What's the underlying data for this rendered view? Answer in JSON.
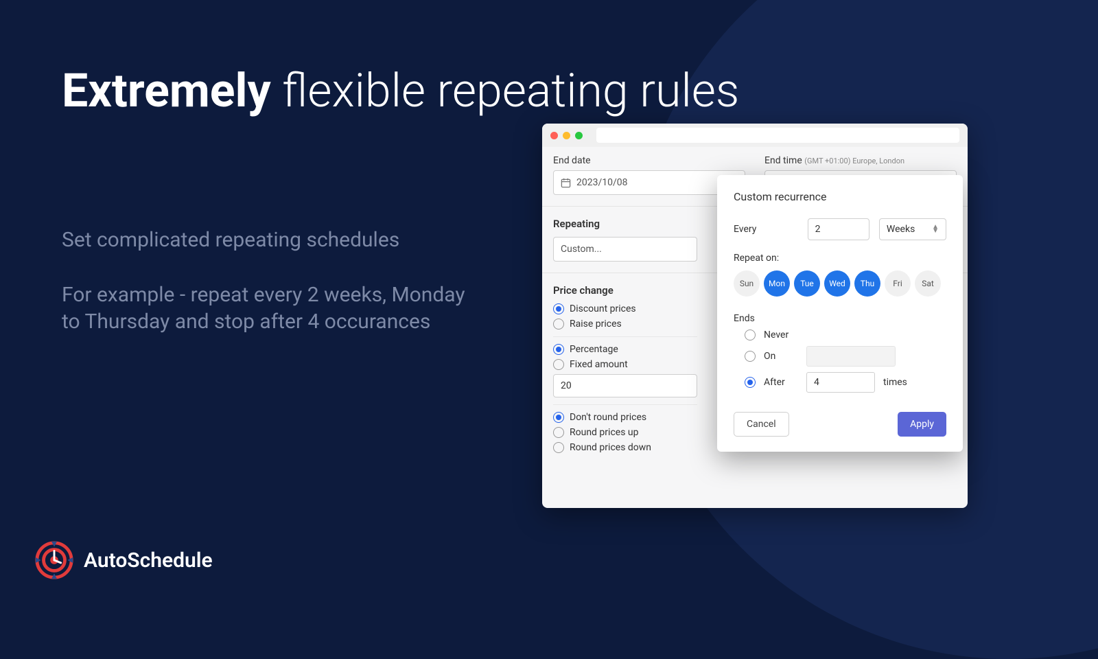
{
  "headline": {
    "bold": "Extremely",
    "rest": " flexible repeating rules"
  },
  "sub1": "Set complicated repeating schedules",
  "sub2": "For example - repeat every 2 weeks, Monday to Thursday and stop after 4 occurances",
  "brand": "AutoSchedule",
  "form": {
    "end_date_label": "End date",
    "end_date_value": "2023/10/08",
    "end_time_label": "End time",
    "end_time_hint": "(GMT +01:00) Europe, London",
    "repeating_title": "Repeating",
    "repeating_value": "Custom...",
    "price_title": "Price change",
    "direction": {
      "discount": "Discount prices",
      "raise": "Raise prices",
      "selected": "discount"
    },
    "mode": {
      "percent": "Percentage",
      "fixed": "Fixed amount",
      "selected": "percent"
    },
    "amount": "20",
    "rounding": {
      "none": "Don't round prices",
      "up": "Round prices up",
      "down": "Round prices down",
      "selected": "none"
    }
  },
  "popup": {
    "title": "Custom recurrence",
    "every_label": "Every",
    "every_value": "2",
    "every_unit": "Weeks",
    "repeat_on_label": "Repeat on:",
    "days": [
      {
        "abbr": "Sun",
        "on": false
      },
      {
        "abbr": "Mon",
        "on": true
      },
      {
        "abbr": "Tue",
        "on": true
      },
      {
        "abbr": "Wed",
        "on": true
      },
      {
        "abbr": "Thu",
        "on": true
      },
      {
        "abbr": "Fri",
        "on": false
      },
      {
        "abbr": "Sat",
        "on": false
      }
    ],
    "ends_label": "Ends",
    "ends": {
      "never": "Never",
      "on": "On",
      "after": "After",
      "selected": "after",
      "after_value": "4",
      "after_unit": "times"
    },
    "cancel": "Cancel",
    "apply": "Apply"
  }
}
